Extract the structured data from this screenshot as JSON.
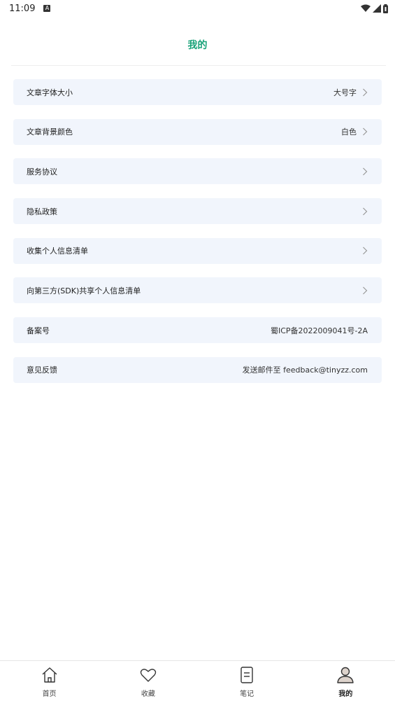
{
  "status_bar": {
    "time": "11:09",
    "notification": "A"
  },
  "header": {
    "title": "我的"
  },
  "settings": [
    {
      "label": "文章字体大小",
      "value": "大号字",
      "chevron": true
    },
    {
      "label": "文章背景颜色",
      "value": "白色",
      "chevron": true
    },
    {
      "label": "服务协议",
      "value": "",
      "chevron": true
    },
    {
      "label": "隐私政策",
      "value": "",
      "chevron": true
    },
    {
      "label": "收集个人信息清单",
      "value": "",
      "chevron": true
    },
    {
      "label": "向第三方(SDK)共享个人信息清单",
      "value": "",
      "chevron": true
    },
    {
      "label": "备案号",
      "value": "蜀ICP备2022009041号-2A",
      "chevron": false
    },
    {
      "label": "意见反馈",
      "value": "发送邮件至 feedback@tinyzz.com",
      "chevron": false
    }
  ],
  "tabs": [
    {
      "label": "首页",
      "icon": "home-icon",
      "active": false
    },
    {
      "label": "收藏",
      "icon": "heart-icon",
      "active": false
    },
    {
      "label": "笔记",
      "icon": "note-icon",
      "active": false
    },
    {
      "label": "我的",
      "icon": "profile-icon",
      "active": true
    }
  ],
  "colors": {
    "accent": "#1aa37a",
    "row_bg": "#f1f5fc"
  }
}
